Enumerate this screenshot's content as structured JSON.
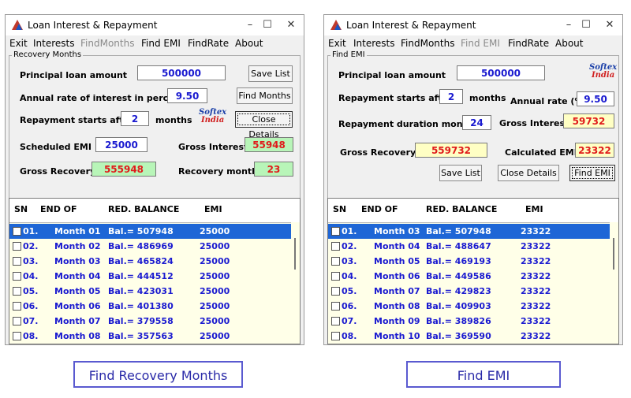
{
  "left": {
    "title": "Loan Interest & Repayment",
    "menu": [
      "Exit",
      "Interests",
      "FindMonths",
      "Find EMI",
      "FindRate",
      "About"
    ],
    "group_label": "Recovery Months",
    "principal_label": "Principal loan amount",
    "principal_value": "500000",
    "rate_label": "Annual rate of interest in percent",
    "rate_value": "9.50",
    "starts_label": "Repayment starts after",
    "starts_value": "2",
    "months_label": "months",
    "emi_label": "Scheduled EMI",
    "emi_value": "25000",
    "gross_interest_label": "Gross Interest",
    "gross_interest_value": "55948",
    "gross_recovery_label": "Gross Recovery",
    "gross_recovery_value": "555948",
    "recovery_months_label": "Recovery months",
    "recovery_months_value": "23",
    "save_btn": "Save List",
    "find_btn": "Find Months",
    "close_btn": "Close Details",
    "headers": [
      "SN",
      "END OF",
      "RED. BALANCE",
      "EMI"
    ],
    "rows": [
      [
        "01.",
        "Month 01",
        "Bal.= 507948",
        "25000"
      ],
      [
        "02.",
        "Month 02",
        "Bal.= 486969",
        "25000"
      ],
      [
        "03.",
        "Month 03",
        "Bal.= 465824",
        "25000"
      ],
      [
        "04.",
        "Month 04",
        "Bal.= 444512",
        "25000"
      ],
      [
        "05.",
        "Month 05",
        "Bal.= 423031",
        "25000"
      ],
      [
        "06.",
        "Month 06",
        "Bal.= 401380",
        "25000"
      ],
      [
        "07.",
        "Month 07",
        "Bal.= 379558",
        "25000"
      ],
      [
        "08.",
        "Month 08",
        "Bal.= 357563",
        "25000"
      ]
    ],
    "caption": "Find Recovery Months"
  },
  "right": {
    "title": "Loan Interest & Repayment",
    "menu": [
      "Exit",
      "Interests",
      "FindMonths",
      "Find EMI",
      "FindRate",
      "About"
    ],
    "group_label": "Find EMI",
    "principal_label": "Principal loan amount",
    "principal_value": "500000",
    "starts_label": "Repayment starts after",
    "starts_value": "2",
    "months_label": "months",
    "rate_label": "Annual rate (%)",
    "rate_value": "9.50",
    "duration_label": "Repayment duration months",
    "duration_value": "24",
    "gross_interest_label": "Gross Interest",
    "gross_interest_value": "59732",
    "gross_recovery_label": "Gross Recovery",
    "gross_recovery_value": "559732",
    "calc_emi_label": "Calculated EMI",
    "calc_emi_value": "23322",
    "save_btn": "Save List",
    "close_btn": "Close Details",
    "find_btn": "Find EMI",
    "headers": [
      "SN",
      "END OF",
      "RED. BALANCE",
      "EMI"
    ],
    "rows": [
      [
        "01.",
        "Month 03",
        "Bal.= 507948",
        "23322"
      ],
      [
        "02.",
        "Month 04",
        "Bal.= 488647",
        "23322"
      ],
      [
        "03.",
        "Month 05",
        "Bal.= 469193",
        "23322"
      ],
      [
        "04.",
        "Month 06",
        "Bal.= 449586",
        "23322"
      ],
      [
        "05.",
        "Month 07",
        "Bal.= 429823",
        "23322"
      ],
      [
        "06.",
        "Month 08",
        "Bal.= 409903",
        "23322"
      ],
      [
        "07.",
        "Month 09",
        "Bal.= 389826",
        "23322"
      ],
      [
        "08.",
        "Month 10",
        "Bal.= 369590",
        "23322"
      ]
    ],
    "caption": "Find EMI"
  },
  "logo": {
    "line1": "Softex",
    "line2": "India"
  },
  "colors": {
    "selection": "#1e66d6",
    "value_text": "#1a1ad0",
    "result_text": "#e01b1b",
    "green_field": "#b8f5b8",
    "yellow_field": "#ffffc4",
    "list_bg": "#ffffe8"
  }
}
